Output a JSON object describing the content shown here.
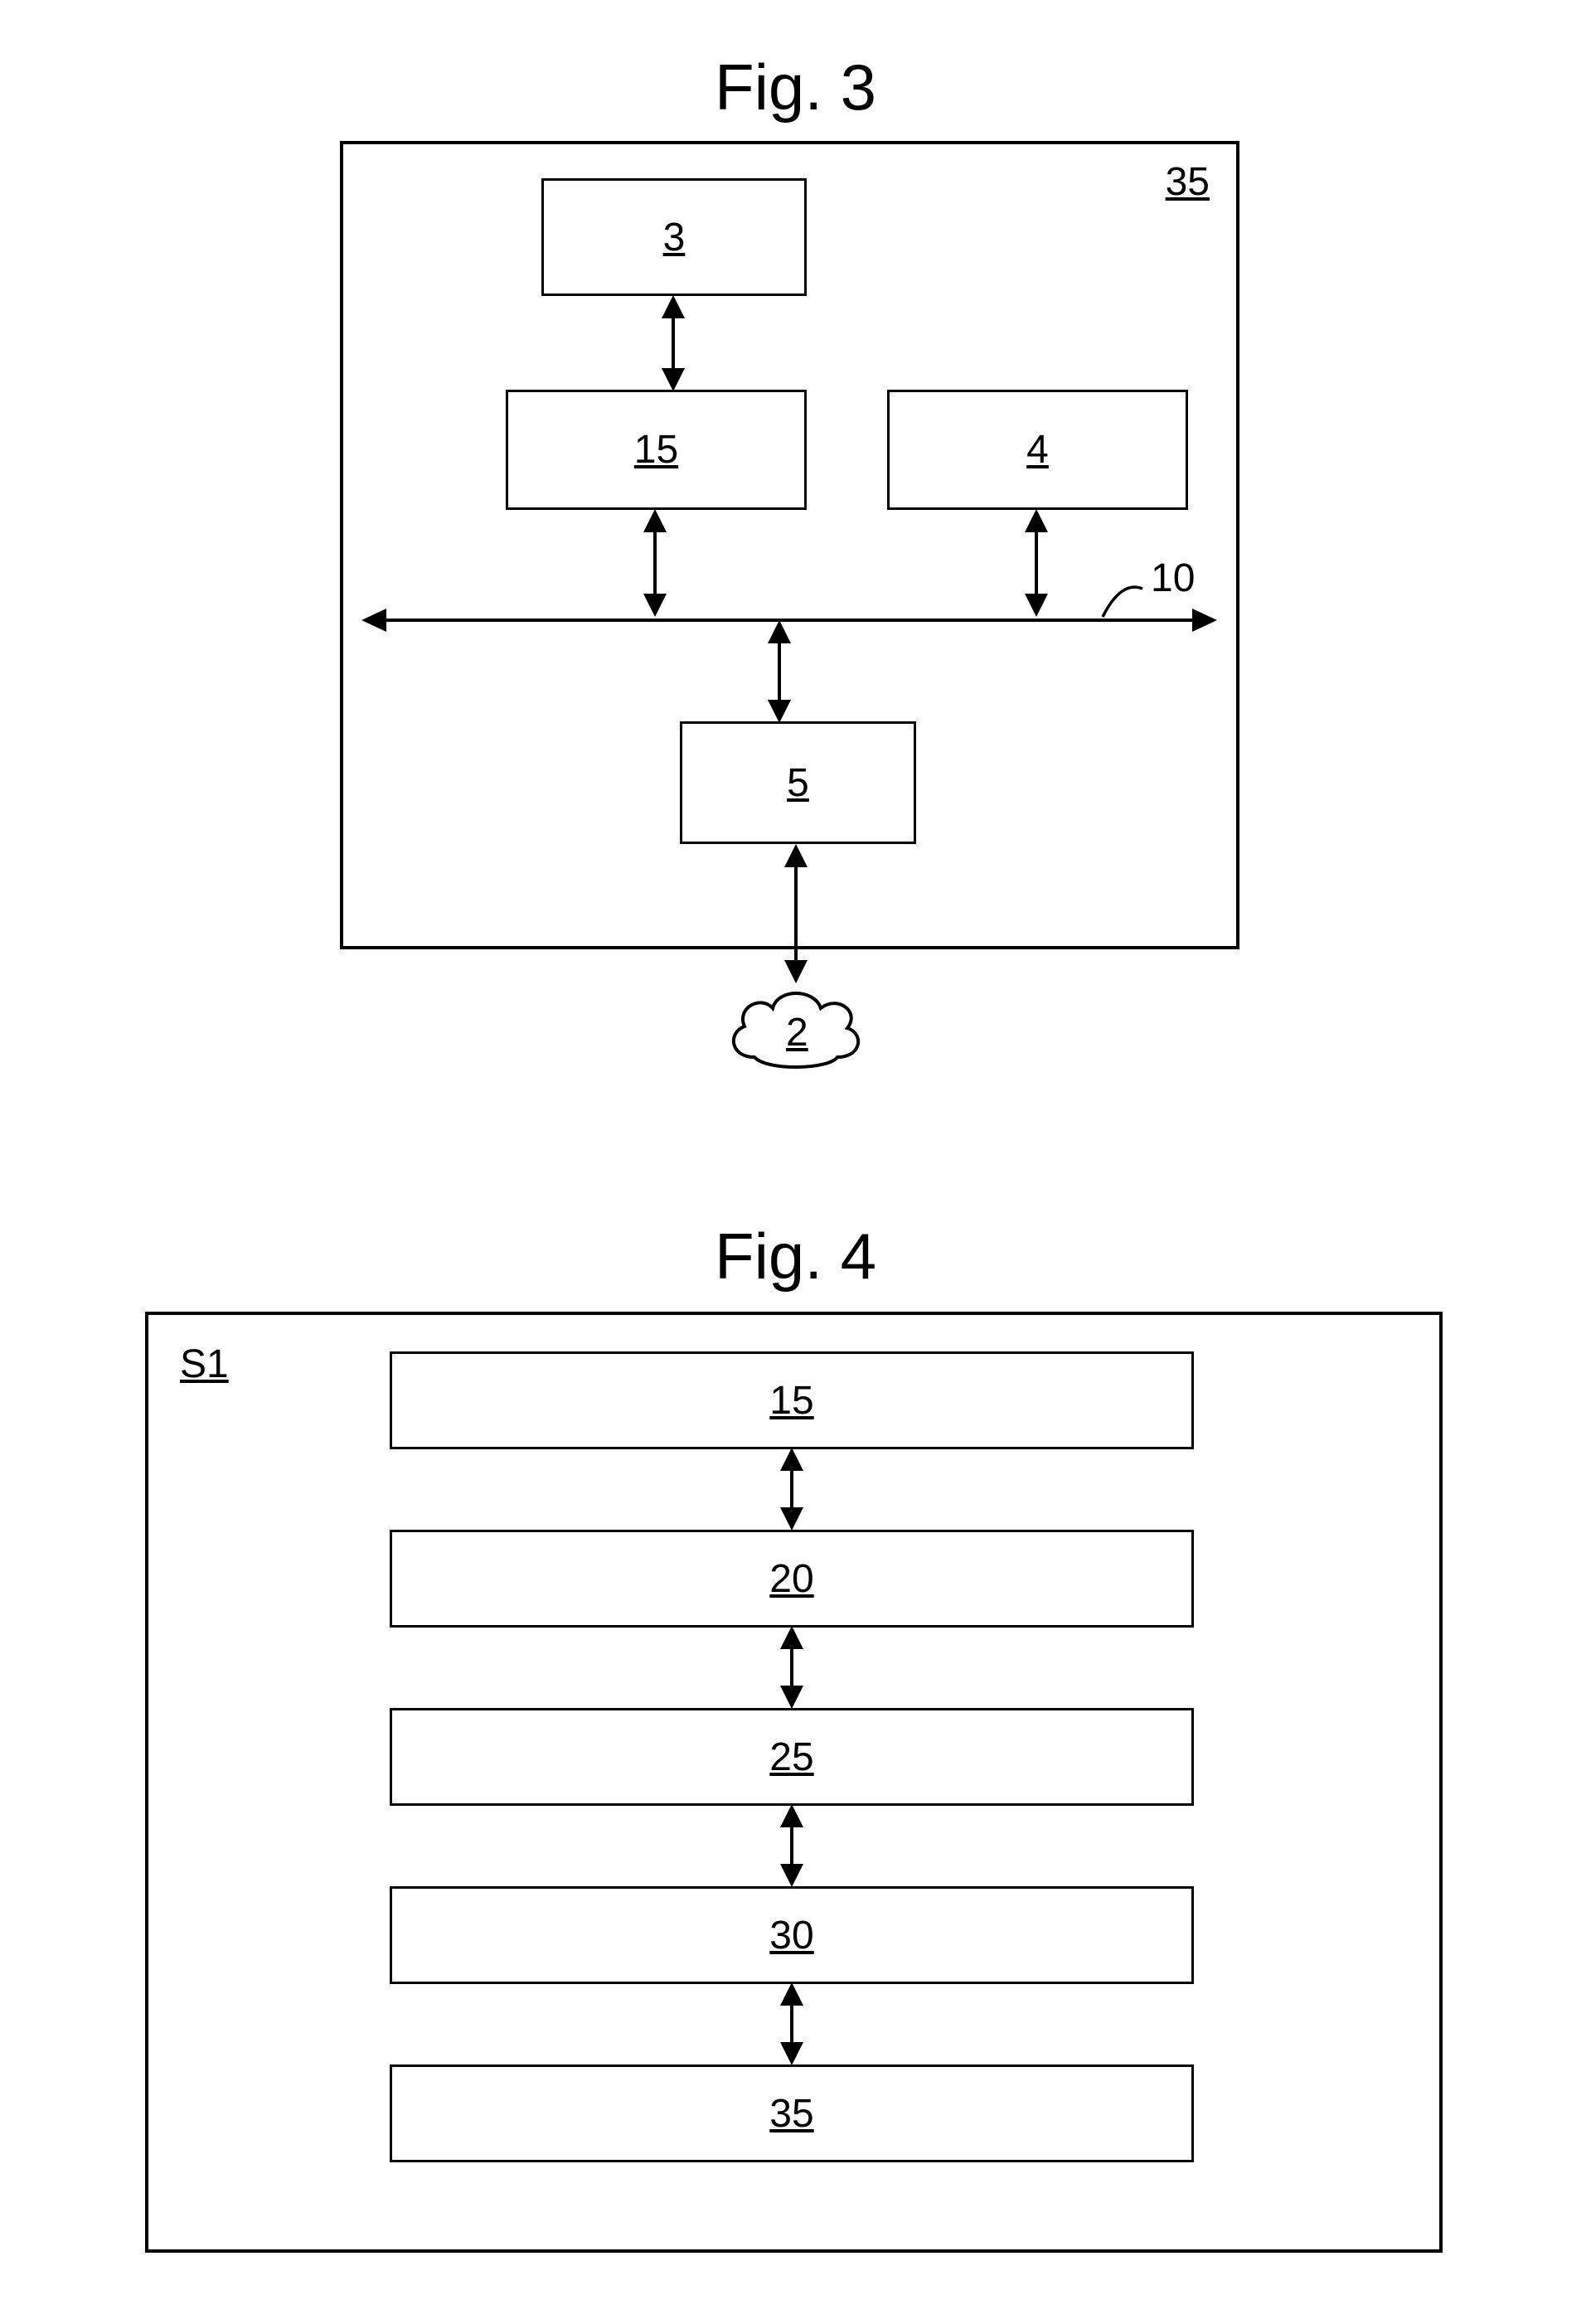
{
  "fig3": {
    "title": "Fig. 3",
    "container_label": "35",
    "boxes": {
      "b3": "3",
      "b15": "15",
      "b4": "4",
      "b5": "5"
    },
    "bus_label": "10",
    "cloud": "2"
  },
  "fig4": {
    "title": "Fig. 4",
    "container_label": "S1",
    "boxes": {
      "b15": "15",
      "b20": "20",
      "b25": "25",
      "b30": "30",
      "b35": "35"
    }
  }
}
